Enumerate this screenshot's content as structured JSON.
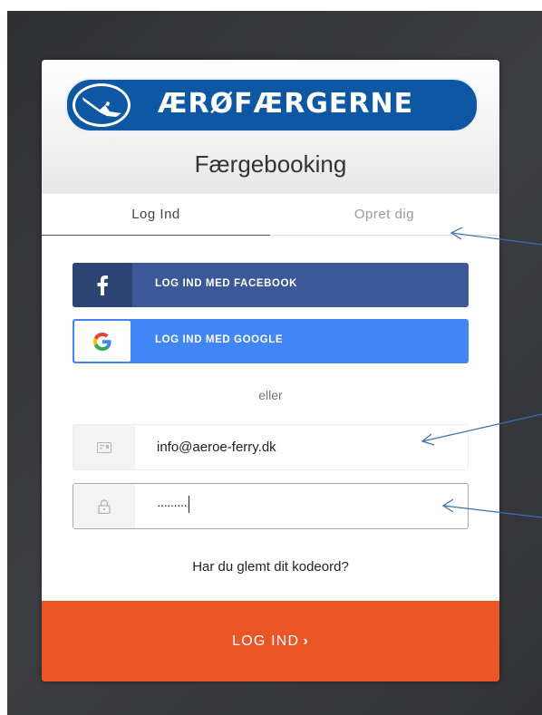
{
  "brand": {
    "logo_text": "ÆRØFÆRGERNE",
    "primary_color": "#0d57a3",
    "accent_color": "#ea5525"
  },
  "page": {
    "title": "Færgebooking"
  },
  "tabs": [
    {
      "label": "Log Ind",
      "active": true
    },
    {
      "label": "Opret dig",
      "active": false
    }
  ],
  "social": {
    "facebook": {
      "label": "LOG IND MED FACEBOOK",
      "icon": "facebook-icon",
      "color": "#3b5998"
    },
    "google": {
      "label": "LOG IND MED GOOGLE",
      "icon": "google-icon",
      "color": "#4285f4"
    }
  },
  "separator": {
    "text": "eller"
  },
  "form": {
    "email": {
      "value": "info@aeroe-ferry.dk",
      "icon": "id-card-icon"
    },
    "password": {
      "value": "·········",
      "icon": "lock-icon"
    }
  },
  "forgot_password": {
    "label": "Har du glemt dit kodeord?"
  },
  "submit": {
    "label": "LOG IND",
    "icon": "chevron-right-icon"
  }
}
